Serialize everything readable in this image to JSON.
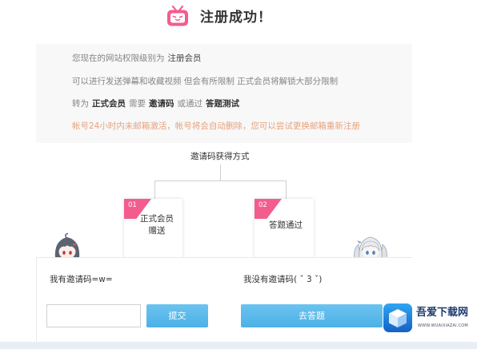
{
  "header": {
    "logo_icon": "bilibili-tv-icon",
    "title": "注册成功！"
  },
  "info": {
    "level_text": "您现在的网站权限级别为",
    "level_value": "注册会员",
    "permission_text": "可以进行发送弹幕和收藏视频 但会有所限制 正式会员将解锁大部分限制",
    "upgrade": {
      "prefix": "转为",
      "target": "正式会员",
      "need": "需要",
      "invite_code": "邀请码",
      "or": "或通过",
      "quiz": "答题测试"
    },
    "warning": "帐号24小时内未邮箱激活，帐号将会自动删除，您可以尝试更换邮箱重新注册"
  },
  "methods": {
    "title": "邀请码获得方式",
    "items": [
      {
        "number": "01",
        "line1": "正式会员",
        "line2": "赠送"
      },
      {
        "number": "02",
        "line1": "答题通过"
      }
    ]
  },
  "invite": {
    "have": {
      "label": "我有邀请码=w=",
      "input_value": "",
      "submit_label": "提交"
    },
    "none": {
      "label": "我没有邀请码( ˇ 3 ˇ)",
      "quiz_label": "去答题"
    }
  },
  "watermark": {
    "icon": "cube-icon",
    "name": "吾爱下载网",
    "url": "WWW.WUAIXIAZAI.COM"
  },
  "colors": {
    "brand_pink": "#f25d8e",
    "button_blue": "#4bb1e6",
    "warning": "#e8a27c",
    "text": "#333333",
    "muted_text": "#858585"
  }
}
